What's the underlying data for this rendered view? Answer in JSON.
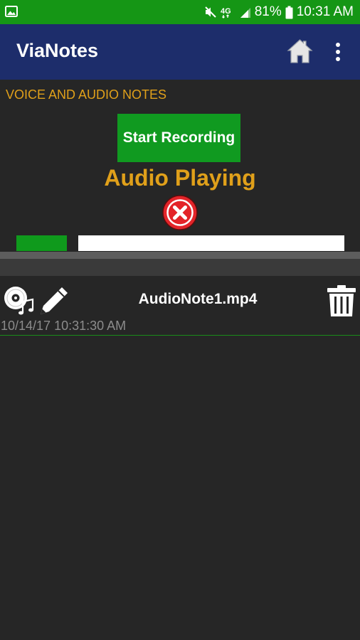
{
  "status_bar": {
    "battery_percent": "81%",
    "time": "10:31 AM",
    "network": "4G",
    "icons": [
      "gallery-icon",
      "mute-icon",
      "lte-icon",
      "signal-icon",
      "battery-icon"
    ]
  },
  "app_bar": {
    "title": "ViaNotes",
    "icons": [
      "home-icon",
      "more-vert-icon"
    ]
  },
  "section": {
    "title": "VOICE AND AUDIO NOTES"
  },
  "controls": {
    "record_label": "Start Recording",
    "playing_status": "Audio Playing",
    "playback_progress": 0.16
  },
  "notes": [
    {
      "name": "AudioNote1.mp4",
      "datetime": "10/14/17 10:31:30 AM",
      "icons": [
        "cd-music-icon",
        "edit-pencil-icon",
        "trash-icon"
      ]
    }
  ],
  "colors": {
    "status_bar": "#159615",
    "app_bar": "#1d2d6b",
    "accent": "#e0a01a",
    "button_green": "#109a20",
    "background": "#262626",
    "stop_red": "#e32429"
  }
}
